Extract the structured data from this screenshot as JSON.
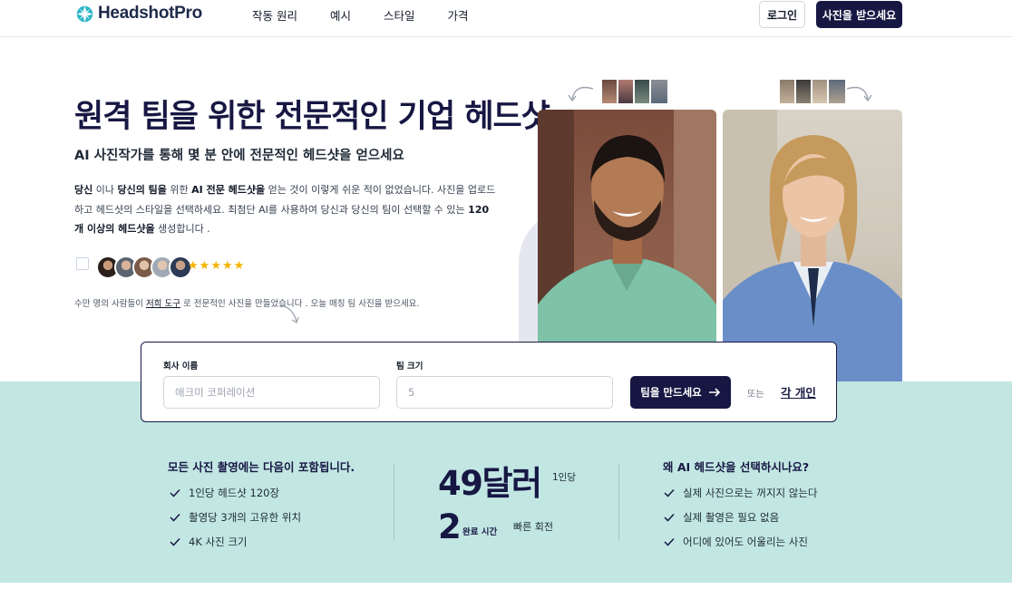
{
  "brand": {
    "name": "HeadshotPro",
    "accent": "#29b6c9",
    "navy": "#171743",
    "mint": "#c2e7e3"
  },
  "nav": {
    "items": [
      "작동 원리",
      "예시",
      "스타일",
      "가격"
    ]
  },
  "header": {
    "login_label": "로그인",
    "cta_label": "사진을 받으세요"
  },
  "hero": {
    "title": "원격 팀을 위한 전문적인 기업 헤드샷",
    "subtitle": "AI 사진작가를 통해 몇 분 안에 전문적인 헤드샷을 얻으세요",
    "desc": {
      "p1": "당신",
      "p2": " 이나 ",
      "p3": "당신의 팀을",
      "p4": " 위한 ",
      "p5": "AI 전문 헤드샷을",
      "p6": " 얻는 것이 이렇게 쉬운 적이 없었습니다. 사진을 업로드하고 헤드샷의 스타일을 선택하세요. 최첨단 AI를 사용하여 당신과 당신의 팀이 선택할 수 있는 ",
      "p7": "120개 이상의 헤드샷을",
      "p8": " 생성합니다 ."
    },
    "rating_stars": 5,
    "social_proof": {
      "before": "수만 명의 사람들이 ",
      "link": "저희 도구",
      "after": " 로 전문적인 사진을 만들었습니다 . 오늘 매칭 팀 사진을 받으세요."
    }
  },
  "form": {
    "company_label": "회사 이름",
    "company_placeholder": "애크미 코퍼레이션",
    "size_label": "팀 크기",
    "size_placeholder": "5",
    "submit_label": "팀을 만드세요",
    "or_label": "또는",
    "individual_label": "각 개인"
  },
  "included": {
    "title": "모든 사진 촬영에는 다음이 포함됩니다.",
    "items": [
      "1인당 헤드샷 120장",
      "촬영당 3개의 고유한 위치",
      "4K 사진 크기"
    ]
  },
  "pricing": {
    "price": "49달러",
    "per": "1인당",
    "turnaround_value": "2",
    "turnaround_unit": "완료 시간",
    "turnaround_desc": "빠른 회전"
  },
  "why": {
    "title": "왜 AI 헤드샷을 선택하시나요?",
    "items": [
      "실제 사진으로는 꺼지지 않는다",
      "실제 촬영은 필요 없음",
      "어디에 있어도 어울리는 사진"
    ]
  }
}
